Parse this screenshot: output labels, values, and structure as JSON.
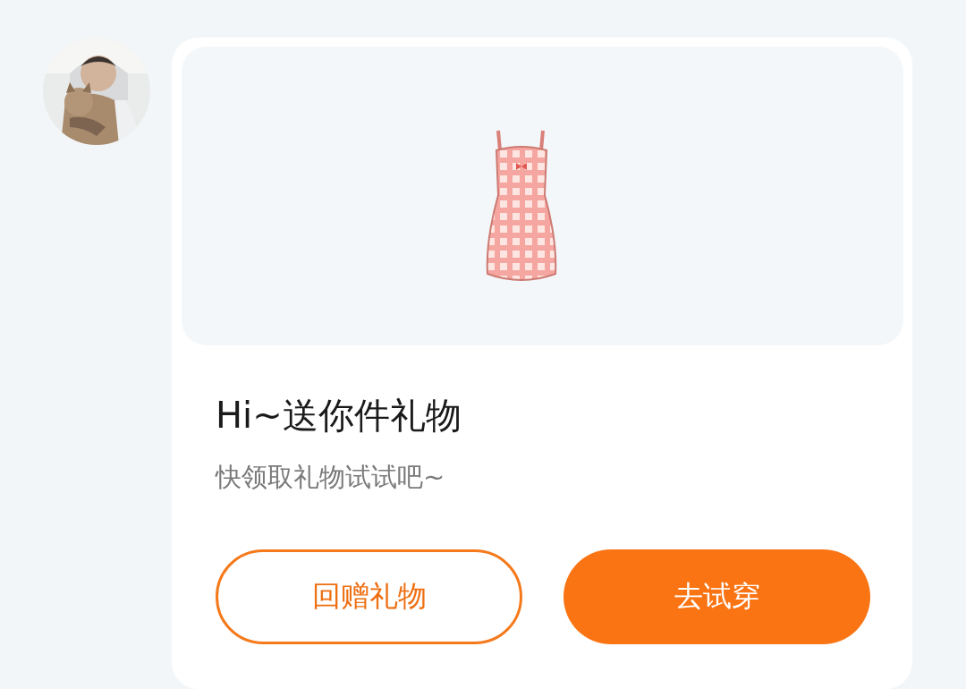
{
  "gift_card": {
    "title": "Hi~送你件礼物",
    "subtitle": "快领取礼物试试吧~",
    "buttons": [
      {
        "label": "回赠礼物",
        "kind": "outline"
      },
      {
        "label": "去试穿",
        "kind": "primary"
      }
    ]
  }
}
